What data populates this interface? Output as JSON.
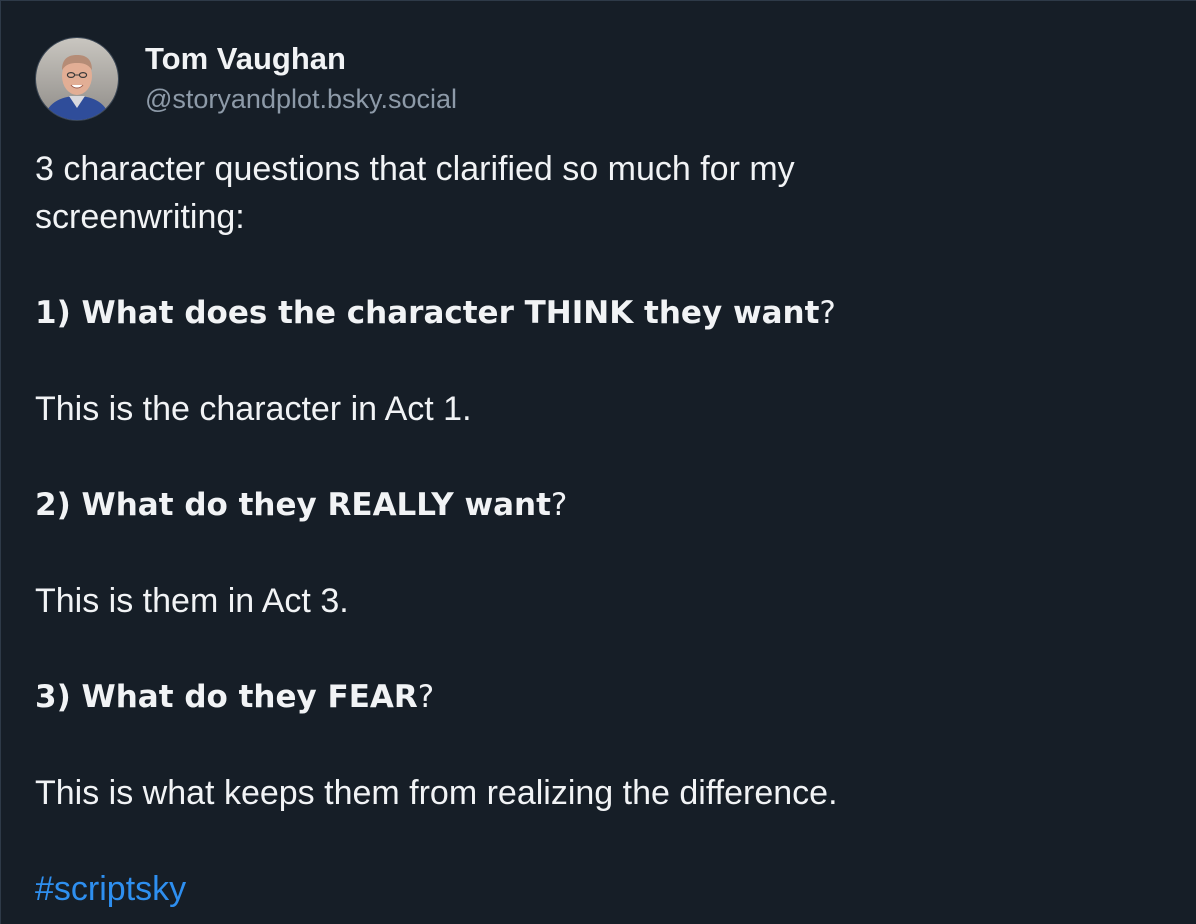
{
  "author": {
    "display_name": "Tom Vaughan",
    "handle": "@storyandplot.bsky.social"
  },
  "post": {
    "intro_line_1": "3 character questions that clarified so much for my",
    "intro_line_2": "screenwriting:",
    "q1_num": "1) ",
    "q1_text": "What does the character THINK they want",
    "q1_mark": "?",
    "a1": "This is the character in Act 1.",
    "q2_num": "2) ",
    "q2_text": "What do they REALLY want",
    "q2_mark": "?",
    "a2": "This is them in Act 3.",
    "q3_num": "3) ",
    "q3_text": "What do they FEAR",
    "q3_mark": "?",
    "a3": "This is what keeps them from realizing the difference.",
    "hashtag": "#scriptsky"
  },
  "colors": {
    "background": "#161e27",
    "text": "#f1f3f5",
    "handle": "#8d9aa8",
    "link": "#2e8ff0"
  }
}
